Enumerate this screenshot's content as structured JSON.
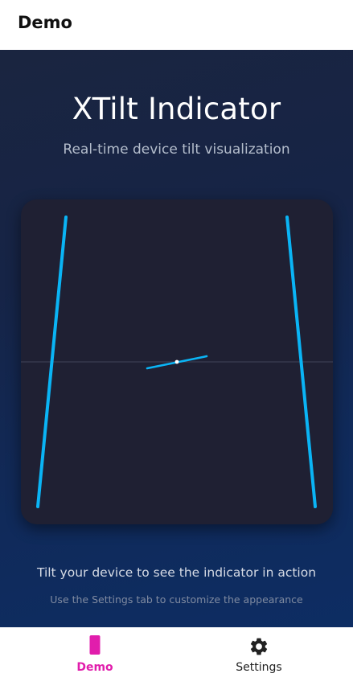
{
  "header": {
    "title": "Demo"
  },
  "main": {
    "title": "XTilt Indicator",
    "subtitle": "Real-time device tilt visualization",
    "hint": "Tilt your device to see the indicator in action",
    "hint_sub": "Use the Settings tab to customize the appearance"
  },
  "indicator": {
    "line_color": "#0ab4f5",
    "horizon_color": "#3a3c52",
    "panel_color": "#1f2033"
  },
  "tabs": [
    {
      "label": "Demo",
      "icon": "phone-icon",
      "active": true
    },
    {
      "label": "Settings",
      "icon": "gear-icon",
      "active": false
    }
  ],
  "colors": {
    "accent": "#e11dac"
  }
}
